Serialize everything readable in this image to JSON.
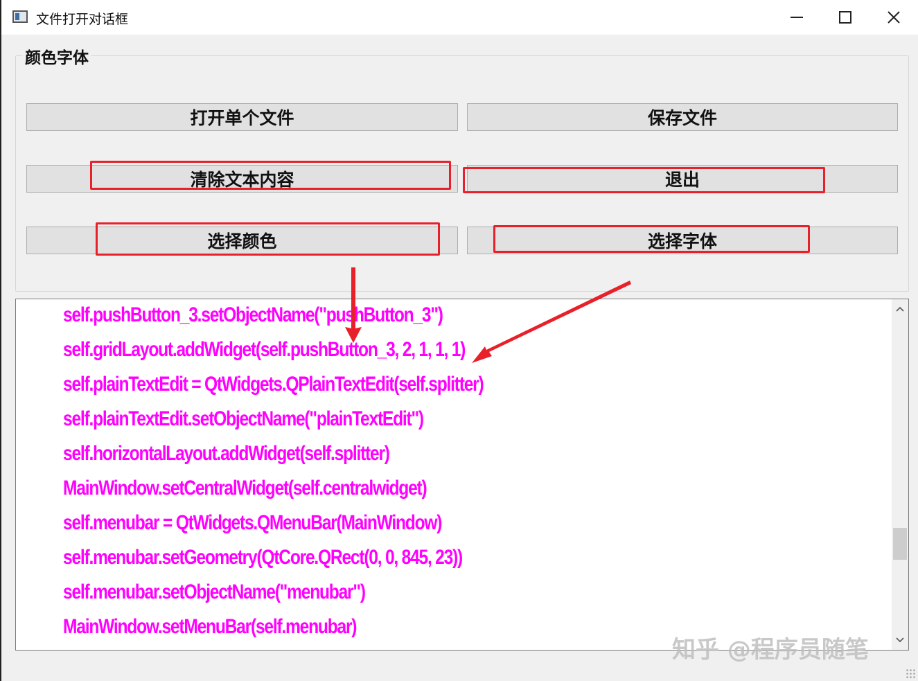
{
  "window": {
    "title": "文件打开对话框",
    "icons": {
      "app": "app-window-icon",
      "minimize": "minimize-icon",
      "maximize": "maximize-icon",
      "close": "close-icon"
    }
  },
  "group": {
    "title": "颜色字体",
    "buttons": {
      "open_single": "打开单个文件",
      "save": "保存文件",
      "clear": "清除文本内容",
      "quit": "退出",
      "pick_color": "选择颜色",
      "pick_font": "选择字体"
    }
  },
  "editor": {
    "lines": [
      "self.pushButton_3.setObjectName(\"pushButton_3\")",
      "self.gridLayout.addWidget(self.pushButton_3, 2, 1, 1, 1)",
      "self.plainTextEdit = QtWidgets.QPlainTextEdit(self.splitter)",
      "self.plainTextEdit.setObjectName(\"plainTextEdit\")",
      "self.horizontalLayout.addWidget(self.splitter)",
      "MainWindow.setCentralWidget(self.centralwidget)",
      "self.menubar = QtWidgets.QMenuBar(MainWindow)",
      "self.menubar.setGeometry(QtCore.QRect(0, 0, 845, 23))",
      "self.menubar.setObjectName(\"menubar\")",
      "MainWindow.setMenuBar(self.menubar)"
    ],
    "text_color": "#ff00ff",
    "scroll_position": 0.78
  },
  "annotations": {
    "highlight_color": "#e8202a"
  },
  "watermark": "知乎 @程序员随笔"
}
